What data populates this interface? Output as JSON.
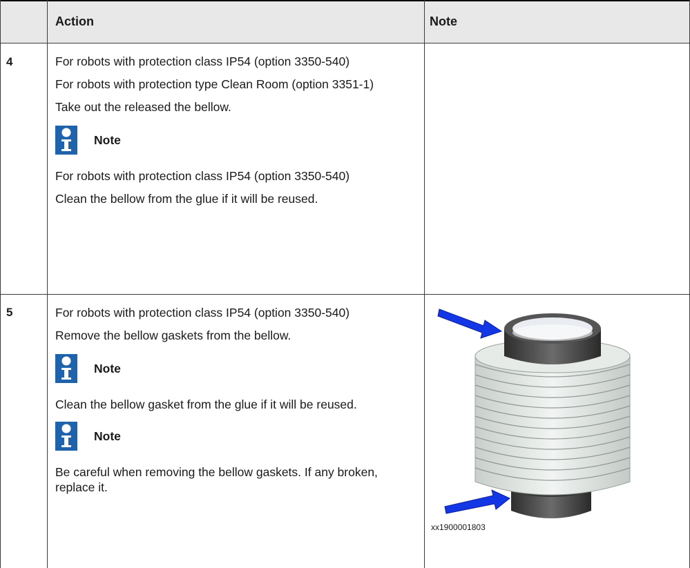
{
  "header": {
    "action": "Action",
    "note": "Note"
  },
  "steps": [
    {
      "number": "4",
      "lines": [
        "For robots with protection class IP54 (option 3350-540)",
        "For robots with protection type Clean Room (option 3351-1)",
        "Take out the released the bellow."
      ],
      "note_label": "Note",
      "note_lines": [
        "For robots with protection class IP54 (option 3350-540)",
        "Clean the bellow from the glue if it will be reused."
      ]
    },
    {
      "number": "5",
      "lines": [
        "For robots with protection class IP54 (option 3350-540)",
        "Remove the bellow gaskets from the bellow."
      ],
      "note1_label": "Note",
      "note1_text": "Clean the bellow gasket from the glue if it will be reused.",
      "note2_label": "Note",
      "note2_text": "Be careful when removing the bellow gaskets. If any broken, replace it.",
      "image_code": "xx1900001803"
    }
  ],
  "icons": {
    "note": "info-person-icon"
  },
  "colors": {
    "note_icon": "#1f63ad",
    "arrow": "#1437e6",
    "header_bg": "#e8e8e8"
  }
}
